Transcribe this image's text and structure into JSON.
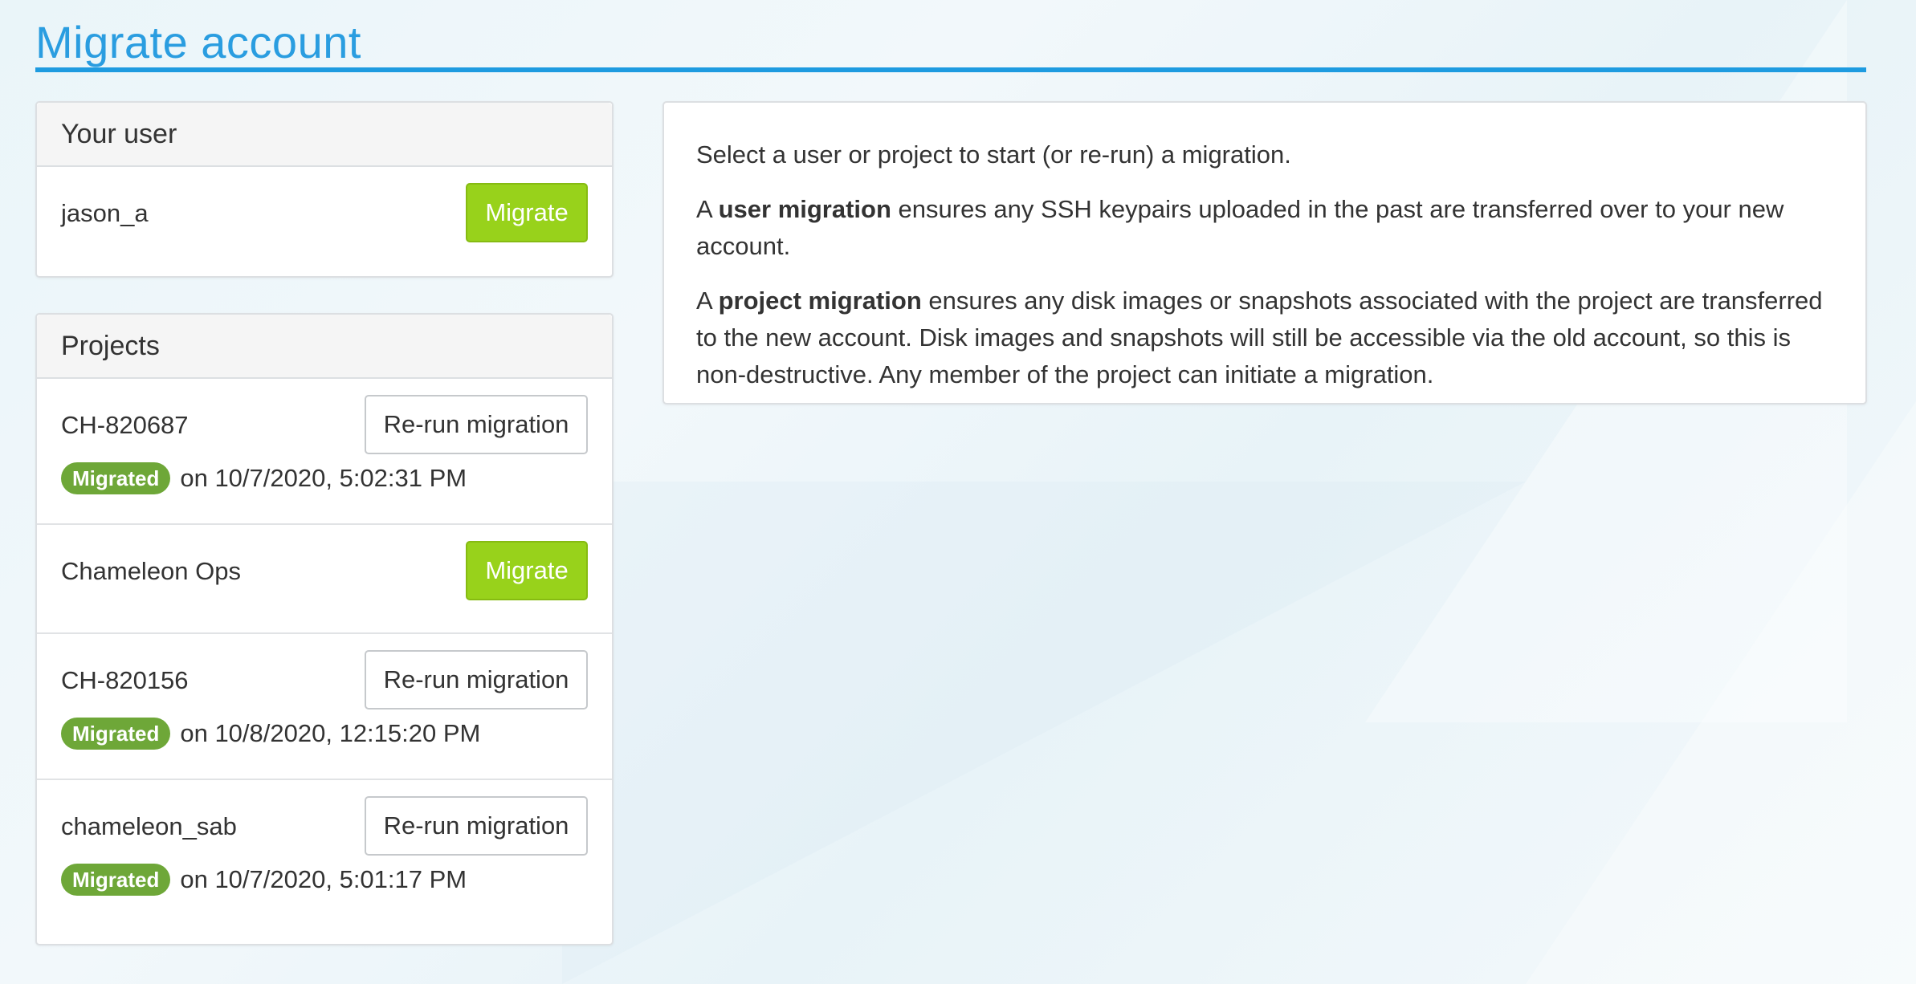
{
  "page": {
    "title": "Migrate account"
  },
  "user_panel": {
    "heading": "Your user",
    "username": "jason_a",
    "migrate_label": "Migrate"
  },
  "projects_panel": {
    "heading": "Projects",
    "projects": [
      {
        "name": "CH-820687",
        "button_label": "Re-run migration",
        "status_badge": "Migrated",
        "status_date": "on 10/7/2020, 5:02:31 PM"
      },
      {
        "name": "Chameleon Ops",
        "button_label": "Migrate"
      },
      {
        "name": "CH-820156",
        "button_label": "Re-run migration",
        "status_badge": "Migrated",
        "status_date": "on 10/8/2020, 12:15:20 PM"
      },
      {
        "name": "chameleon_sab",
        "button_label": "Re-run migration",
        "status_badge": "Migrated",
        "status_date": "on 10/7/2020, 5:01:17 PM"
      }
    ]
  },
  "info": {
    "intro": "Select a user or project to start (or re-run) a migration.",
    "user_prefix": "A ",
    "user_term": "user migration",
    "user_text": " ensures any SSH keypairs uploaded in the past are transferred over to your new account.",
    "project_prefix": "A ",
    "project_term": "project migration",
    "project_text": " ensures any disk images or snapshots associated with the project are transferred to the new account. Disk images and snapshots will still be accessible via the old account, so this is non-destructive. Any member of the project can initiate a migration."
  },
  "colors": {
    "title_blue": "#2a9de0",
    "migrate_green": "#98d21b",
    "badge_green": "#6ea738"
  }
}
